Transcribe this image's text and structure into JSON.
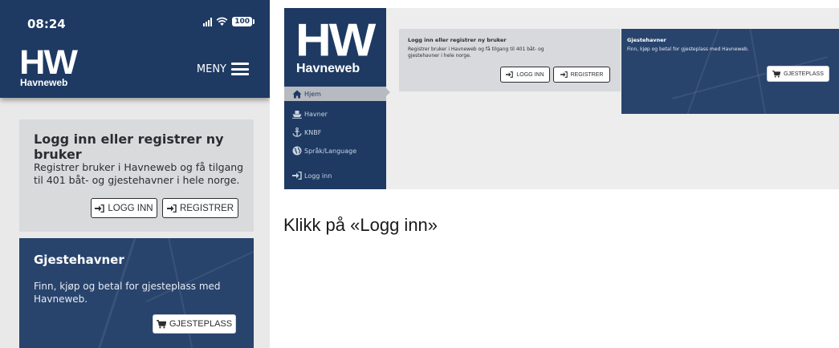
{
  "phone": {
    "status_time": "08:24",
    "battery": "100",
    "logo_mark": "HW",
    "logo_text": "Havneweb",
    "menu_label": "MENY",
    "login_card": {
      "title": "Logg inn eller registrer ny bruker",
      "description": "Registrer bruker i Havneweb og få tilgang til 401 båt- og gjestehavner i hele norge.",
      "login_button": "LOGG INN",
      "register_button": "REGISTRER"
    },
    "guest_card": {
      "title": "Gjestehavner",
      "description": "Finn, kjøp og betal for gjesteplass med Havneweb.",
      "button": "GJESTEPLASS"
    }
  },
  "desktop": {
    "logo_mark": "HW",
    "logo_text": "Havneweb",
    "nav": [
      {
        "label": "Hjem",
        "icon": "home-icon",
        "active": true
      },
      {
        "label": "Havner",
        "icon": "ship-icon",
        "active": false
      },
      {
        "label": "KNBF",
        "icon": "anchor-icon",
        "active": false
      },
      {
        "label": "Språk/Language",
        "icon": "globe-icon",
        "active": false
      },
      {
        "label": "Logg inn",
        "icon": "sign-in-icon",
        "active": false
      }
    ],
    "login_card": {
      "title": "Logg inn eller registrer ny bruker",
      "description": "Registrer bruker i Havneweb og få tilgang til 401 båt- og gjestehavner i hele norge.",
      "login_button": "LOGG INN",
      "register_button": "REGISTRER"
    },
    "guest_card": {
      "title": "Gjestehavner",
      "description": "Finn, kjøp og betal for gjesteplass med Havneweb.",
      "button": "GJESTEPLASS"
    }
  },
  "caption": "Klikk på «Logg inn»",
  "colors": {
    "brand_navy": "#1e3a63",
    "card_grey": "#d9dadc",
    "page_grey": "#e9e9ea"
  }
}
